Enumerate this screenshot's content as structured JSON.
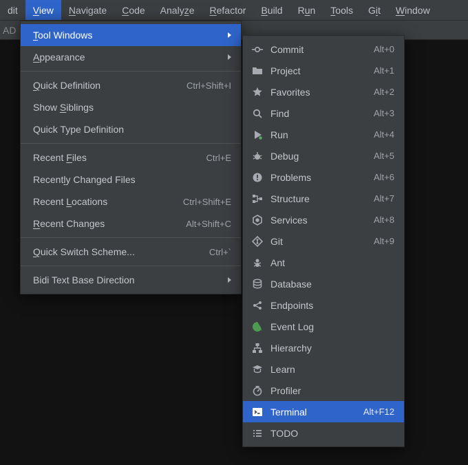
{
  "menubar": {
    "items": [
      {
        "pre": "",
        "u": "",
        "post": "dit"
      },
      {
        "pre": "",
        "u": "V",
        "post": "iew"
      },
      {
        "pre": "",
        "u": "N",
        "post": "avigate"
      },
      {
        "pre": "",
        "u": "C",
        "post": "ode"
      },
      {
        "pre": "Analy",
        "u": "z",
        "post": "e"
      },
      {
        "pre": "",
        "u": "R",
        "post": "efactor"
      },
      {
        "pre": "",
        "u": "B",
        "post": "uild"
      },
      {
        "pre": "R",
        "u": "u",
        "post": "n"
      },
      {
        "pre": "",
        "u": "T",
        "post": "ools"
      },
      {
        "pre": "G",
        "u": "i",
        "post": "t"
      },
      {
        "pre": "",
        "u": "W",
        "post": "indow"
      }
    ],
    "active_index": 1
  },
  "toolbar_left_text": "AD",
  "view_menu": {
    "items": [
      {
        "label_pre": "",
        "label_u": "T",
        "label_post": "ool Windows",
        "shortcut": "",
        "arrow": true,
        "highlight": true
      },
      {
        "label_pre": "",
        "label_u": "A",
        "label_post": "ppearance",
        "shortcut": "",
        "arrow": true
      },
      "sep",
      {
        "label_pre": "",
        "label_u": "Q",
        "label_post": "uick Definition",
        "shortcut": "Ctrl+Shift+I"
      },
      {
        "label_pre": "Show ",
        "label_u": "S",
        "label_post": "iblings",
        "shortcut": ""
      },
      {
        "label_pre": "Quick Type Definition",
        "label_u": "",
        "label_post": "",
        "shortcut": ""
      },
      "sep",
      {
        "label_pre": "Recent ",
        "label_u": "F",
        "label_post": "iles",
        "shortcut": "Ctrl+E"
      },
      {
        "label_pre": "Recent",
        "label_u": "l",
        "label_post": "y Changed Files",
        "shortcut": ""
      },
      {
        "label_pre": "Recent ",
        "label_u": "L",
        "label_post": "ocations",
        "shortcut": "Ctrl+Shift+E"
      },
      {
        "label_pre": "",
        "label_u": "R",
        "label_post": "ecent Changes",
        "shortcut": "Alt+Shift+C"
      },
      "sep",
      {
        "label_pre": "",
        "label_u": "Q",
        "label_post": "uick Switch Scheme...",
        "shortcut": "Ctrl+`"
      },
      "sep",
      {
        "label_pre": "Bidi Text Base Direction",
        "label_u": "",
        "label_post": "",
        "shortcut": "",
        "arrow": true
      }
    ]
  },
  "tool_windows": {
    "items": [
      {
        "icon": "commit",
        "label": "Commit",
        "shortcut": "Alt+0"
      },
      {
        "icon": "folder",
        "label": "Project",
        "shortcut": "Alt+1"
      },
      {
        "icon": "star",
        "label": "Favorites",
        "shortcut": "Alt+2"
      },
      {
        "icon": "search",
        "label": "Find",
        "shortcut": "Alt+3"
      },
      {
        "icon": "run",
        "label": "Run",
        "shortcut": "Alt+4"
      },
      {
        "icon": "debug",
        "label": "Debug",
        "shortcut": "Alt+5"
      },
      {
        "icon": "problems",
        "label": "Problems",
        "shortcut": "Alt+6"
      },
      {
        "icon": "structure",
        "label": "Structure",
        "shortcut": "Alt+7"
      },
      {
        "icon": "services",
        "label": "Services",
        "shortcut": "Alt+8"
      },
      {
        "icon": "git",
        "label": "Git",
        "shortcut": "Alt+9"
      },
      {
        "icon": "ant",
        "label": "Ant",
        "shortcut": ""
      },
      {
        "icon": "database",
        "label": "Database",
        "shortcut": ""
      },
      {
        "icon": "endpoints",
        "label": "Endpoints",
        "shortcut": ""
      },
      {
        "icon": "eventlog",
        "label": "Event Log",
        "shortcut": ""
      },
      {
        "icon": "hierarchy",
        "label": "Hierarchy",
        "shortcut": ""
      },
      {
        "icon": "learn",
        "label": "Learn",
        "shortcut": ""
      },
      {
        "icon": "profiler",
        "label": "Profiler",
        "shortcut": ""
      },
      {
        "icon": "terminal",
        "label": "Terminal",
        "shortcut": "Alt+F12",
        "highlight": true
      },
      {
        "icon": "todo",
        "label": "TODO",
        "shortcut": ""
      }
    ]
  }
}
